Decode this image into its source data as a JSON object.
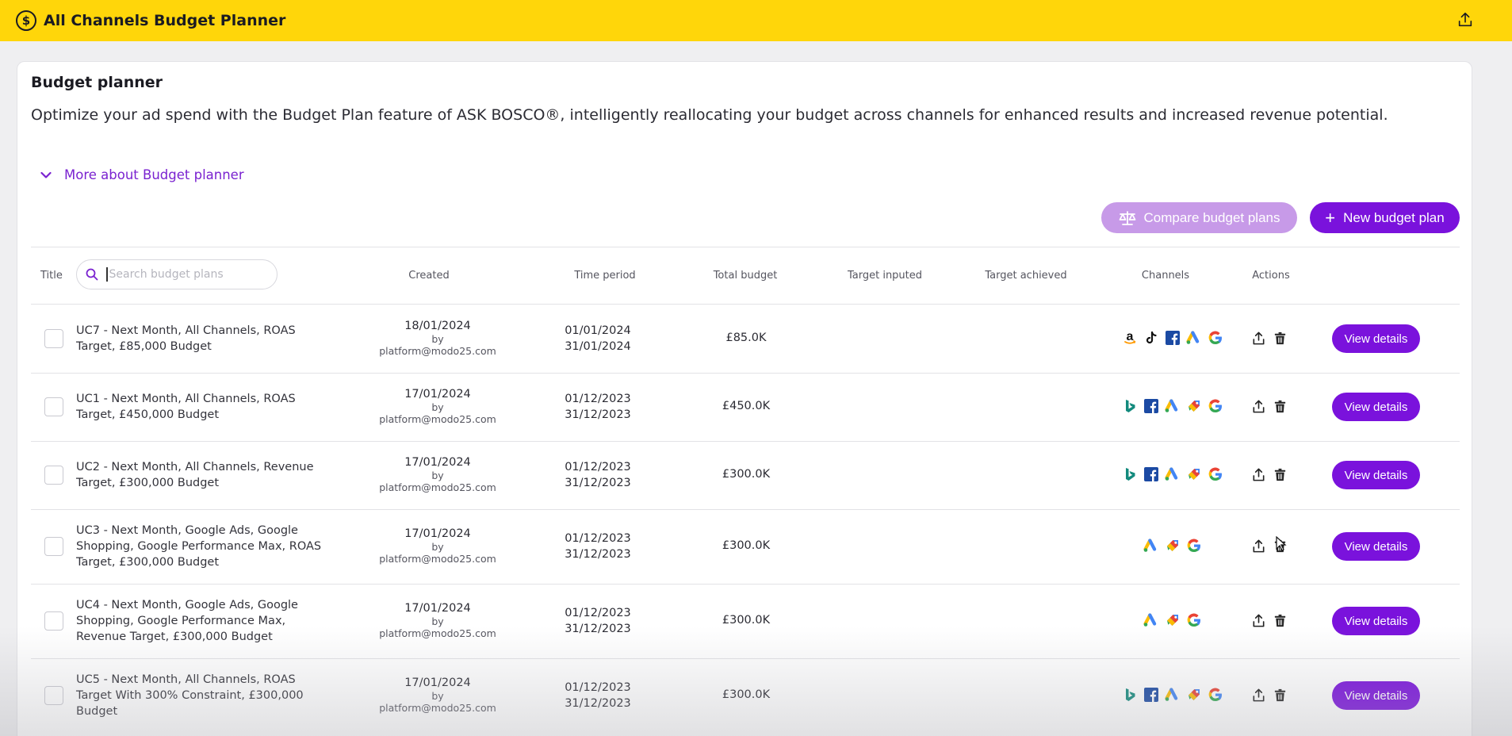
{
  "app": {
    "title": "All Channels Budget Planner",
    "logo_icon": "dollar-circle-icon",
    "share_icon": "share-icon"
  },
  "card": {
    "title": "Budget planner",
    "description": "Optimize your ad spend with the Budget Plan feature of ASK BOSCO®, intelligently reallocating your budget across channels for enhanced results and increased revenue potential.",
    "more_label": "More about Budget planner"
  },
  "toolbar": {
    "compare_label": "Compare budget plans",
    "new_label": "New budget plan"
  },
  "search": {
    "placeholder": "Search budget plans"
  },
  "columns": {
    "title": "Title",
    "created": "Created",
    "time_period": "Time period",
    "total_budget": "Total budget",
    "target_inputed": "Target inputed",
    "target_achieved": "Target achieved",
    "channels": "Channels",
    "actions": "Actions"
  },
  "view_label": "View details",
  "colors": {
    "brand_yellow": "#ffd60a",
    "accent_purple": "#7a12dc",
    "compare_purple": "#c79ae8",
    "link_purple": "#7a22d0"
  },
  "rows": [
    {
      "title": "UC7 - Next Month, All Channels, ROAS Target, £85,000 Budget",
      "created_date": "18/01/2024",
      "by": "by",
      "created_by": "platform@modo25.com",
      "start": "01/01/2024",
      "end": "31/01/2024",
      "budget": "£85.0K",
      "channels": [
        "amazon",
        "tiktok",
        "facebook",
        "google-ads",
        "google"
      ]
    },
    {
      "title": "UC1 - Next Month, All Channels, ROAS Target, £450,000 Budget",
      "created_date": "17/01/2024",
      "by": "by",
      "created_by": "platform@modo25.com",
      "start": "01/12/2023",
      "end": "31/12/2023",
      "budget": "£450.0K",
      "channels": [
        "bing",
        "facebook",
        "google-ads",
        "google-shopping",
        "google"
      ]
    },
    {
      "title": "UC2 - Next Month, All Channels, Revenue Target, £300,000 Budget",
      "created_date": "17/01/2024",
      "by": "by",
      "created_by": "platform@modo25.com",
      "start": "01/12/2023",
      "end": "31/12/2023",
      "budget": "£300.0K",
      "channels": [
        "bing",
        "facebook",
        "google-ads",
        "google-shopping",
        "google"
      ]
    },
    {
      "title": "UC3 - Next Month, Google Ads, Google Shopping, Google Performance Max, ROAS Target, £300,000 Budget",
      "created_date": "17/01/2024",
      "by": "by",
      "created_by": "platform@modo25.com",
      "start": "01/12/2023",
      "end": "31/12/2023",
      "budget": "£300.0K",
      "channels": [
        "google-ads",
        "google-shopping",
        "google"
      ]
    },
    {
      "title": "UC4 - Next Month, Google Ads, Google Shopping, Google Performance Max, Revenue Target, £300,000 Budget",
      "created_date": "17/01/2024",
      "by": "by",
      "created_by": "platform@modo25.com",
      "start": "01/12/2023",
      "end": "31/12/2023",
      "budget": "£300.0K",
      "channels": [
        "google-ads",
        "google-shopping",
        "google"
      ]
    },
    {
      "title": "UC5 - Next Month, All Channels, ROAS Target With 300% Constraint, £300,000 Budget",
      "created_date": "17/01/2024",
      "by": "by",
      "created_by": "platform@modo25.com",
      "start": "01/12/2023",
      "end": "31/12/2023",
      "budget": "£300.0K",
      "channels": [
        "bing",
        "facebook",
        "google-ads",
        "google-shopping",
        "google"
      ]
    }
  ]
}
